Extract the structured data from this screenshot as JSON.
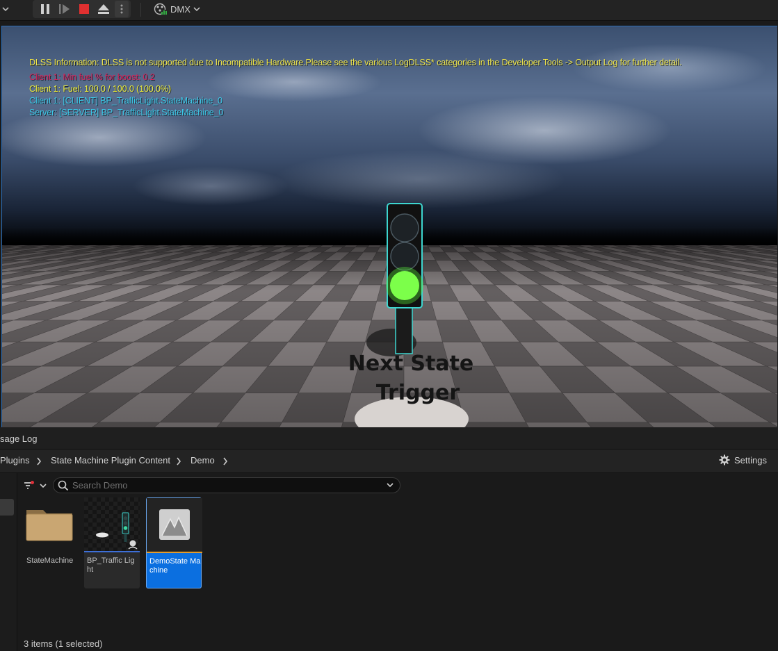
{
  "toolbar": {
    "pause_icon": "pause-icon",
    "step_icon": "frame-skip-icon",
    "stop_icon": "stop-icon",
    "eject_icon": "eject-icon",
    "more_icon": "vertical-ellipsis-icon",
    "dmx_label": "DMX",
    "stop_color": "#e03030"
  },
  "viewport": {
    "messages": [
      {
        "text": "DLSS Information: DLSS is not supported due to Incompatible Hardware.Please see the various LogDLSS* categories in the Developer Tools -> Output Log for further detail.",
        "color": "#f0e64a"
      },
      {
        "text": "Client 1: Min fuel % for boost: 0.2",
        "color": "#d8245c"
      },
      {
        "text": "Client 1: Fuel: 100.0 / 100.0 (100.0%)",
        "color": "#f0f03c"
      },
      {
        "text": "Client 1: [CLIENT] BP_TrafficLight.StateMachine_0",
        "color": "#3cc8e8"
      },
      {
        "text": "Server: [SERVER] BP_TrafficLight.StateMachine_0",
        "color": "#3cc8e8"
      }
    ],
    "trigger_label_line1": "Next State",
    "trigger_label_line2": "Trigger",
    "traffic_light_active_color": "#7cff4a"
  },
  "message_log": {
    "tab_label": "sage Log"
  },
  "breadcrumb": {
    "items": [
      "Plugins",
      "State Machine Plugin Content",
      "Demo"
    ]
  },
  "settings_label": "Settings",
  "search": {
    "placeholder": "Search Demo"
  },
  "assets": [
    {
      "label": "StateMachine",
      "type": "folder",
      "selected": false
    },
    {
      "label": "BP_Traffic Light",
      "type": "blueprint",
      "selected": false
    },
    {
      "label": "DemoState Machine",
      "type": "state-machine",
      "selected": true
    }
  ],
  "status_text": "3 items (1 selected)"
}
